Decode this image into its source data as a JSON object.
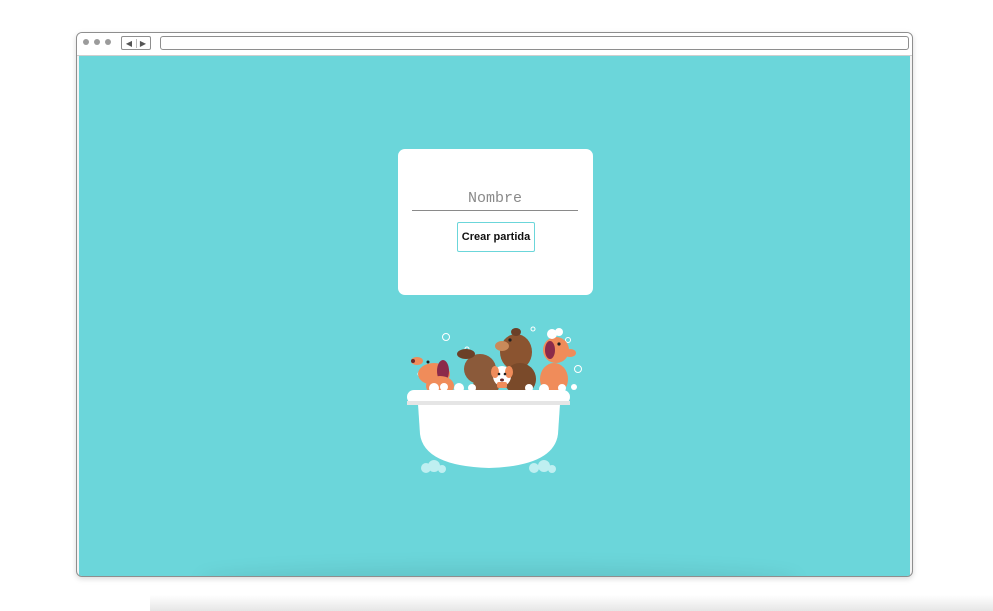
{
  "form": {
    "name_placeholder": "Nombre",
    "name_value": "",
    "create_button_label": "Crear partida"
  },
  "colors": {
    "page_background": "#6bd6da",
    "card_background": "#ffffff",
    "button_border": "#6bd6da"
  },
  "illustration": {
    "icon": "dogs-in-bathtub-illustration"
  }
}
